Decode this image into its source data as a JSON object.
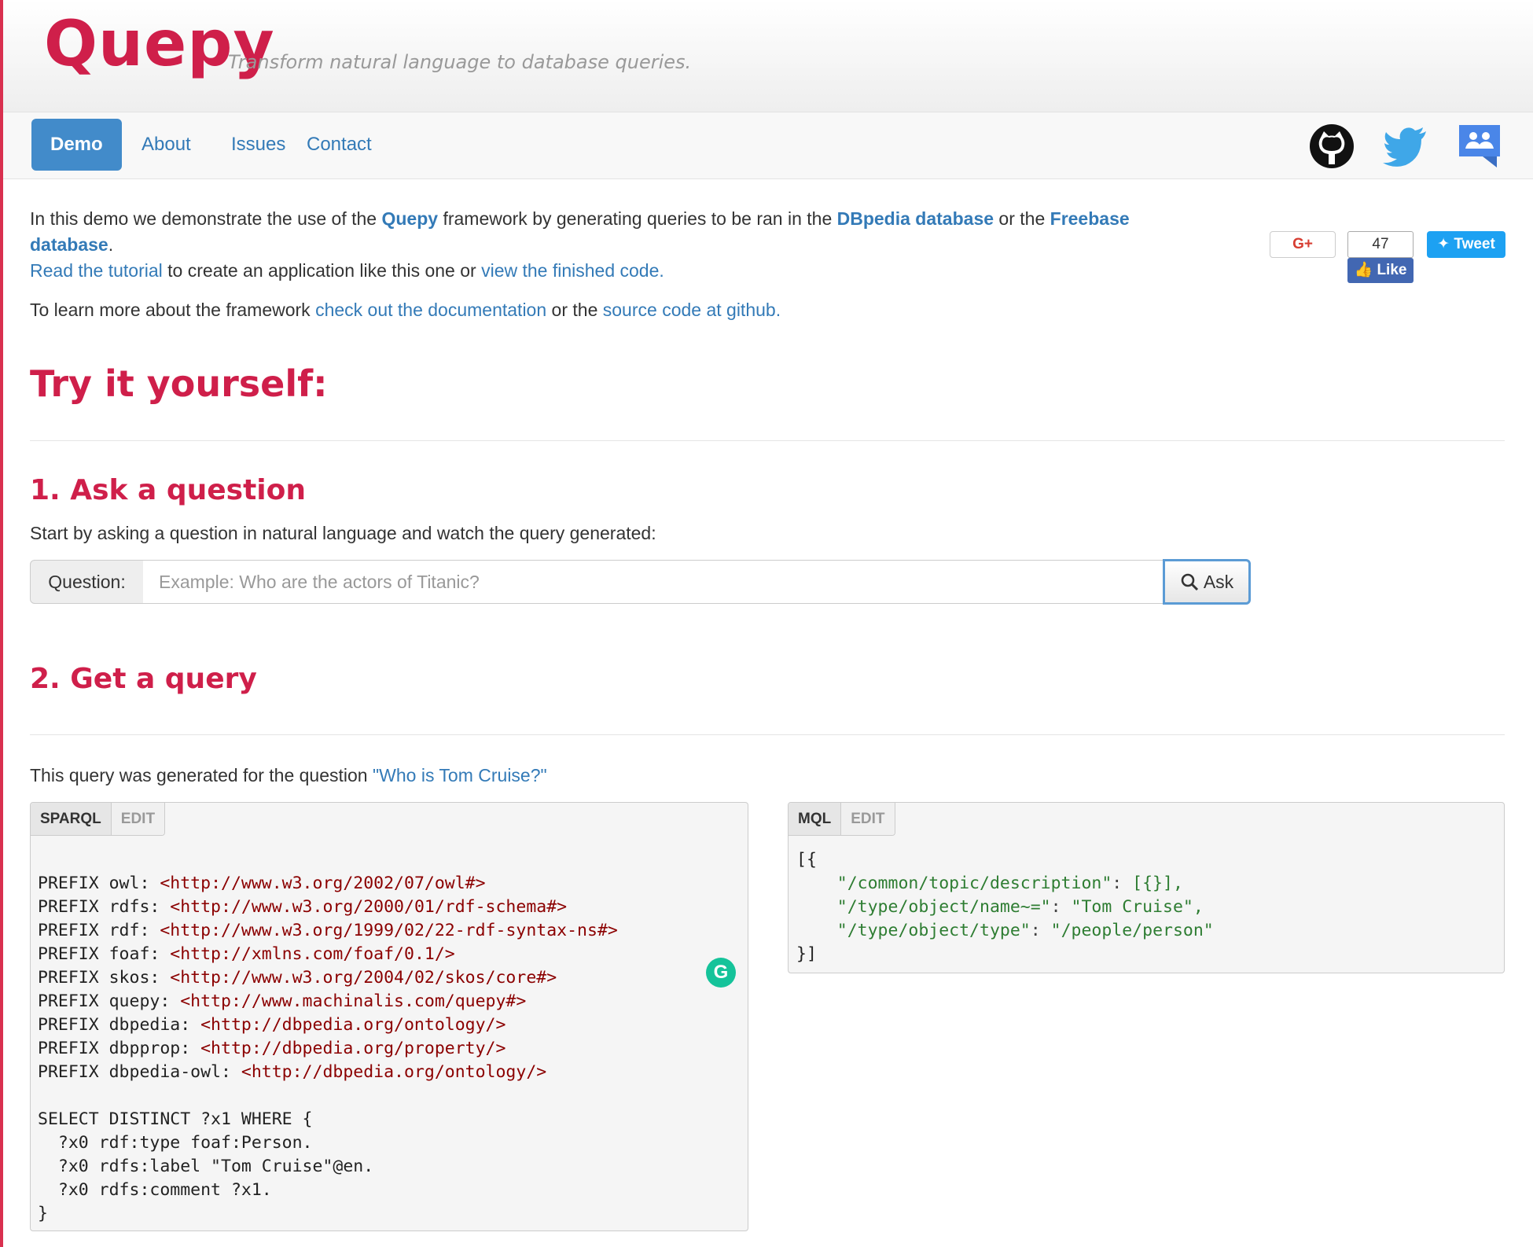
{
  "header": {
    "brand": "Quepy",
    "tagline": "Transform natural language to database queries."
  },
  "nav": {
    "items": [
      {
        "label": "Demo",
        "active": true
      },
      {
        "label": "About"
      },
      {
        "label": "Issues"
      },
      {
        "label": "Contact"
      }
    ],
    "icons": [
      "github-icon",
      "twitter-icon",
      "google-groups-icon"
    ]
  },
  "intro": {
    "t1": "In this demo we demonstrate the use of the ",
    "quepy": "Quepy",
    "t2": " framework by generating queries to be ran in the ",
    "dbpedia": "DBpedia database",
    "t3": " or the ",
    "freebase": "Freebase database",
    "t4": ".",
    "tutorial": "Read the tutorial",
    "t5": " to create an application like this one or ",
    "finished": "view the finished code.",
    "t6": "To learn more about the framework ",
    "docs": "check out the documentation",
    "t7": " or the ",
    "source": "source code at github."
  },
  "social": {
    "gplus": "G+",
    "like_count": "47",
    "like": "Like",
    "tweet": "Tweet"
  },
  "try": {
    "heading": "Try it yourself:"
  },
  "ask": {
    "heading": "1. Ask a question",
    "desc": "Start by asking a question in natural language and watch the query generated:",
    "addon": "Question:",
    "placeholder": "Example: Who are the actors of Titanic?",
    "button": "Ask"
  },
  "query": {
    "heading": "2. Get a query",
    "desc": "This query was generated for the question ",
    "question": "\"Who is Tom Cruise?\""
  },
  "sparql": {
    "tab": "SPARQL",
    "edit": "EDIT",
    "prefixes": [
      {
        "name": "owl",
        "uri": "http://www.w3.org/2002/07/owl#"
      },
      {
        "name": "rdfs",
        "uri": "http://www.w3.org/2000/01/rdf-schema#"
      },
      {
        "name": "rdf",
        "uri": "http://www.w3.org/1999/02/22-rdf-syntax-ns#"
      },
      {
        "name": "foaf",
        "uri": "http://xmlns.com/foaf/0.1/"
      },
      {
        "name": "skos",
        "uri": "http://www.w3.org/2004/02/skos/core#"
      },
      {
        "name": "quepy",
        "uri": "http://www.machinalis.com/quepy#"
      },
      {
        "name": "dbpedia",
        "uri": "http://dbpedia.org/ontology/"
      },
      {
        "name": "dbpprop",
        "uri": "http://dbpedia.org/property/"
      },
      {
        "name": "dbpedia-owl",
        "uri": "http://dbpedia.org/ontology/"
      }
    ],
    "select": "SELECT DISTINCT ?x1 WHERE {",
    "triples": [
      "?x0 rdf:type foaf:Person.",
      "?x0 rdfs:label \"Tom Cruise\"@en.",
      "?x0 rdfs:comment ?x1."
    ],
    "close": "}"
  },
  "mql": {
    "tab": "MQL",
    "edit": "EDIT",
    "open": "[{",
    "lines": [
      {
        "key": "\"/common/topic/description\"",
        "val": "[{}],"
      },
      {
        "key": "\"/type/object/name~=\"",
        "val": "\"Tom Cruise\","
      },
      {
        "key": "\"/type/object/type\"",
        "val": "\"/people/person\""
      }
    ],
    "close": "}]"
  },
  "colors": {
    "brand": "#cf1f4a",
    "link": "#337ab7",
    "nav_active": "#428bca"
  }
}
